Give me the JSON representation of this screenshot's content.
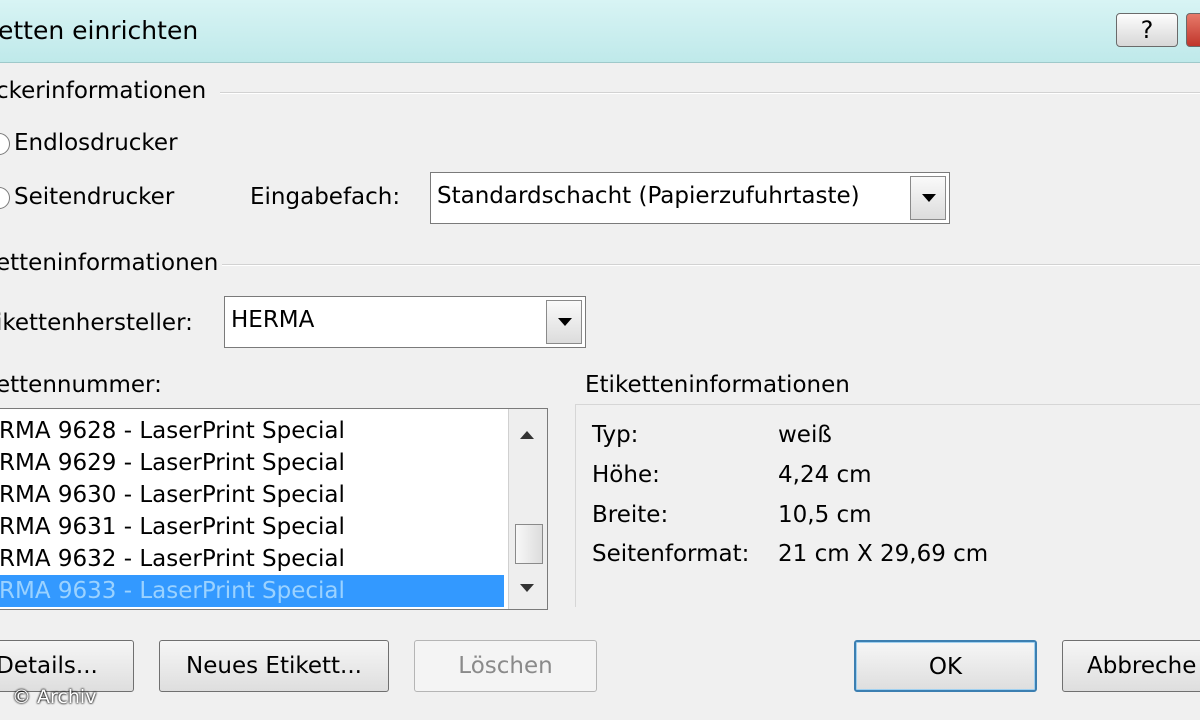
{
  "window": {
    "title": "etten einrichten",
    "help_label": "?"
  },
  "printer_info": {
    "group_label": "ckerinformationen",
    "continuous_label": "Endlosdrucker",
    "page_label": "Seitendrucker",
    "tray_label": "Eingabefach:",
    "tray_value": "Standardschacht (Papierzufuhrtaste)"
  },
  "label_info": {
    "group_label": "etteninformationen",
    "vendor_label": "ikettenhersteller:",
    "vendor_value": "HERMA",
    "number_label": "ettennummer:",
    "items": [
      "RMA 9628 - LaserPrint Special",
      "RMA 9629 - LaserPrint Special",
      "RMA 9630 - LaserPrint Special",
      "RMA 9631 - LaserPrint Special",
      "RMA 9632 - LaserPrint Special",
      "RMA 9633 - LaserPrint Special"
    ],
    "selected_index": 5
  },
  "details": {
    "group_label": "Etiketteninformationen",
    "type_key": "Typ:",
    "type_val": "weiß",
    "height_key": "Höhe:",
    "height_val": "4,24 cm",
    "width_key": "Breite:",
    "width_val": "10,5 cm",
    "format_key": "Seitenformat:",
    "format_val": "21 cm X 29,69 cm"
  },
  "buttons": {
    "details": "Details...",
    "new_label": "Neues Etikett...",
    "delete": "Löschen",
    "ok": "OK",
    "cancel": "Abbreche"
  },
  "watermark": "© Archiv"
}
